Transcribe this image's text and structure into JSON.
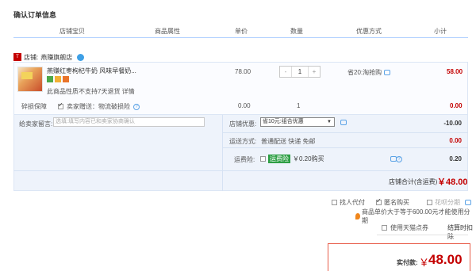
{
  "title": "确认订单信息",
  "columns": [
    "店铺宝贝",
    "商品属性",
    "单价",
    "数量",
    "优惠方式",
    "小计"
  ],
  "store": {
    "label": "店铺:",
    "name": "燕赚旗舰店"
  },
  "item": {
    "name": "燕赚红枣枸杞牛奶 风味早餐奶...",
    "no_return": "此商品性质不支持7天退货 详情",
    "price": "78.00",
    "qty": "1",
    "qty_minus": "-",
    "qty_plus": "+",
    "promo": "省20:淘抢购",
    "subtotal": "58.00"
  },
  "guarantee": {
    "label": "碎损保障",
    "option": "卖家赠送：物流破损险",
    "price": "0.00",
    "qty": "1",
    "subtotal": "0.00"
  },
  "message": {
    "label": "给卖家留言:",
    "placeholder": "选填:填写内容已和卖家协商确认"
  },
  "store_discount": {
    "label": "店铺优惠:",
    "selected": "省10元:组合优惠",
    "value": "-10.00"
  },
  "shipping": {
    "label": "运送方式:",
    "method": "普通配送 快递 免邮",
    "value": "0.00"
  },
  "insurance": {
    "label": "运费险:",
    "badge": "运费险",
    "text": "￥0.20购买",
    "value": "0.20"
  },
  "store_total": {
    "label": "店铺合计(含运费)",
    "value": "￥48.00"
  },
  "options": {
    "proxy": "找人代付",
    "anonymous": "匿名购买",
    "installment": "花呗分期"
  },
  "notice": "商品单价大于等于600.00元才能使用分期",
  "tmall_points": "使用天猫点券",
  "pay_button": "结算时扣除",
  "payment": {
    "label": "实付款:",
    "currency": "￥",
    "value": "48.00"
  },
  "colors": {
    "accent": "#c40000",
    "border": "#e85d4a",
    "header_line": "#b2d1ff"
  }
}
